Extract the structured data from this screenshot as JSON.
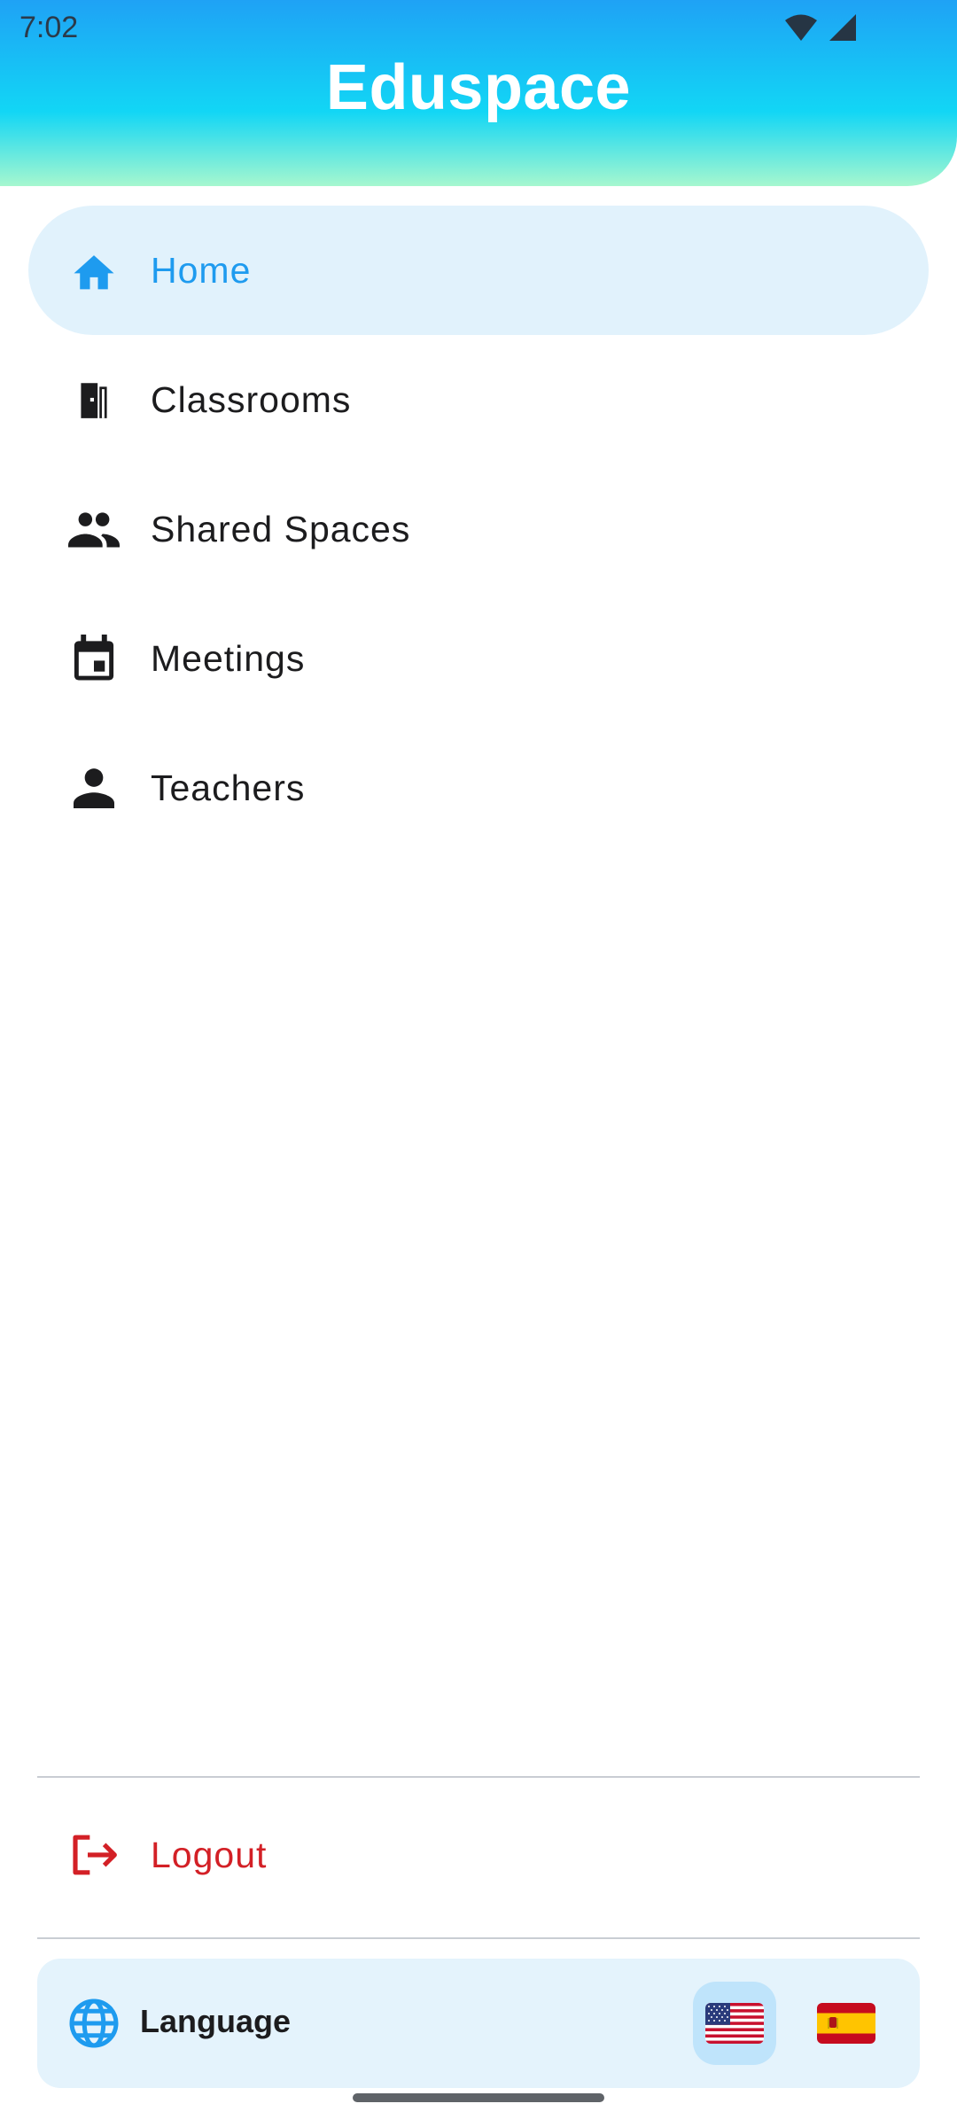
{
  "status_bar": {
    "time": "7:02"
  },
  "header": {
    "title": "Eduspace"
  },
  "nav": {
    "items": [
      {
        "label": "Home",
        "icon": "home-icon",
        "active": true
      },
      {
        "label": "Classrooms",
        "icon": "door-icon",
        "active": false
      },
      {
        "label": "Shared Spaces",
        "icon": "people-icon",
        "active": false
      },
      {
        "label": "Meetings",
        "icon": "calendar-icon",
        "active": false
      },
      {
        "label": "Teachers",
        "icon": "person-icon",
        "active": false
      }
    ]
  },
  "logout": {
    "label": "Logout",
    "icon": "logout-icon"
  },
  "language": {
    "label": "Language",
    "icon": "globe-icon",
    "options": [
      {
        "flag": "us-flag-icon",
        "selected": true
      },
      {
        "flag": "spain-flag-icon",
        "selected": false
      }
    ]
  },
  "colors": {
    "accent": "#1e9bef",
    "active_bg": "#e1f2fc",
    "logout": "#d32026",
    "language_bg": "#e4f3fc"
  }
}
